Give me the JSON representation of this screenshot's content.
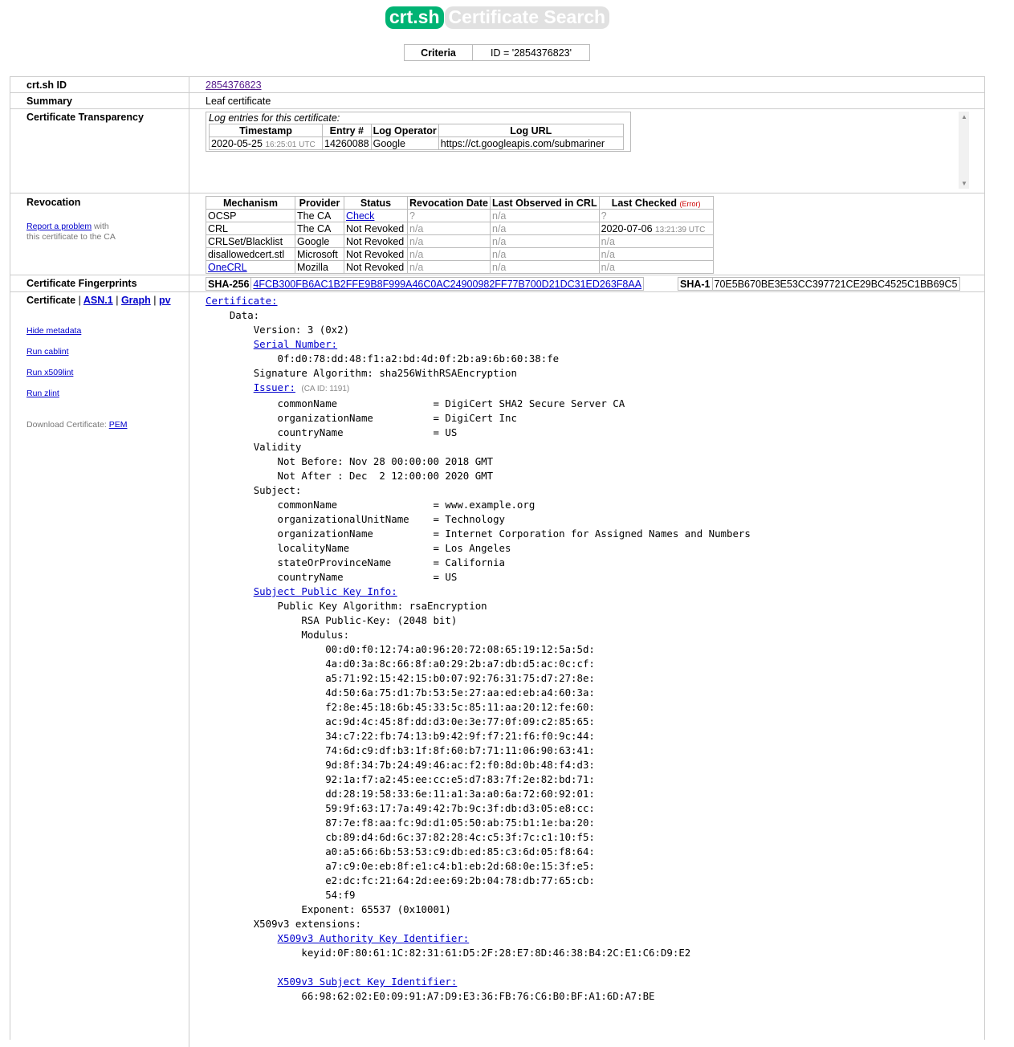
{
  "header": {
    "logo": "crt.sh",
    "title": "Certificate Search"
  },
  "criteria": {
    "label": "Criteria",
    "value": "ID = '2854376823'"
  },
  "rows": {
    "id_label": "crt.sh ID",
    "id_value": "2854376823",
    "summary_label": "Summary",
    "summary_value": "Leaf certificate",
    "ct_label": "Certificate Transparency",
    "revocation_label": "Revocation",
    "fingerprints_label": "Certificate Fingerprints",
    "certificate_label": "Certificate"
  },
  "ct": {
    "caption": "Log entries for this certificate:",
    "headers": [
      "Timestamp",
      "Entry #",
      "Log Operator",
      "Log URL"
    ],
    "entry": {
      "date": "2020-05-25",
      "time": "16:25:01 UTC",
      "entry": "14260088",
      "operator": "Google",
      "url": "https://ct.googleapis.com/submariner"
    }
  },
  "revocation": {
    "report_link": "Report a problem",
    "report_text1": "with",
    "report_text2": "this certificate to the CA",
    "headers": [
      "Mechanism",
      "Provider",
      "Status",
      "Revocation Date",
      "Last Observed in CRL",
      "Last Checked"
    ],
    "error_label": "(Error)",
    "rows": [
      {
        "mechanism": "OCSP",
        "provider": "The CA",
        "status": "Check",
        "revdate": "?",
        "observed": "n/a",
        "checked": "?",
        "checked_time": ""
      },
      {
        "mechanism": "CRL",
        "provider": "The CA",
        "status": "Not Revoked",
        "revdate": "n/a",
        "observed": "n/a",
        "checked": "2020-07-06",
        "checked_time": "13:21:39 UTC"
      },
      {
        "mechanism": "CRLSet/Blacklist",
        "provider": "Google",
        "status": "Not Revoked",
        "revdate": "n/a",
        "observed": "n/a",
        "checked": "n/a",
        "checked_time": ""
      },
      {
        "mechanism": "disallowedcert.stl",
        "provider": "Microsoft",
        "status": "Not Revoked",
        "revdate": "n/a",
        "observed": "n/a",
        "checked": "n/a",
        "checked_time": ""
      },
      {
        "mechanism": "OneCRL",
        "provider": "Mozilla",
        "status": "Not Revoked",
        "revdate": "n/a",
        "observed": "n/a",
        "checked": "n/a",
        "checked_time": ""
      }
    ]
  },
  "fingerprints": {
    "sha256_label": "SHA-256",
    "sha256": "4FCB300FB6AC1B2FFE9B8F999A46C0AC24900982FF77B700D21DC31ED263F8AA",
    "sha1_label": "SHA-1",
    "sha1": "70E5B670BE3E53CC397721CE29BC4525C1BB69C5"
  },
  "certificate_links": {
    "sep": "|",
    "asn1": "ASN.1",
    "graph": "Graph",
    "pv": "pv",
    "hide_metadata": "Hide metadata",
    "run_cablint": "Run cablint",
    "run_x509lint": "Run x509lint",
    "run_zlint": "Run zlint",
    "download_label": "Download Certificate:",
    "download_pem": "PEM"
  },
  "cert_text": {
    "certificate": "Certificate:",
    "data": "Data:",
    "version": "Version: 3 (0x2)",
    "serial_label": "Serial Number:",
    "serial": "0f:d0:78:dd:48:f1:a2:bd:4d:0f:2b:a9:6b:60:38:fe",
    "sigalg": "Signature Algorithm: sha256WithRSAEncryption",
    "issuer_label": "Issuer:",
    "issuer_caid": "(CA ID: 1191)",
    "issuer_lines": [
      "commonName                = DigiCert SHA2 Secure Server CA",
      "organizationName          = DigiCert Inc",
      "countryName               = US"
    ],
    "validity": "Validity",
    "not_before": "Not Before: Nov 28 00:00:00 2018 GMT",
    "not_after": "Not After : Dec  2 12:00:00 2020 GMT",
    "subject": "Subject:",
    "subject_lines": [
      "commonName                = www.example.org",
      "organizationalUnitName    = Technology",
      "organizationName          = Internet Corporation for Assigned Names and Numbers",
      "localityName              = Los Angeles",
      "stateOrProvinceName       = California",
      "countryName               = US"
    ],
    "spki_label": "Subject Public Key Info:",
    "pk_alg": "Public Key Algorithm: rsaEncryption",
    "rsa_key": "RSA Public-Key: (2048 bit)",
    "modulus": "Modulus:",
    "modulus_lines": [
      "00:d0:f0:12:74:a0:96:20:72:08:65:19:12:5a:5d:",
      "4a:d0:3a:8c:66:8f:a0:29:2b:a7:db:d5:ac:0c:cf:",
      "a5:71:92:15:42:15:b0:07:92:76:31:75:d7:27:8e:",
      "4d:50:6a:75:d1:7b:53:5e:27:aa:ed:eb:a4:60:3a:",
      "f2:8e:45:18:6b:45:33:5c:85:11:aa:20:12:fe:60:",
      "ac:9d:4c:45:8f:dd:d3:0e:3e:77:0f:09:c2:85:65:",
      "34:c7:22:fb:74:13:b9:42:9f:f7:21:f6:f0:9c:44:",
      "74:6d:c9:df:b3:1f:8f:60:b7:71:11:06:90:63:41:",
      "9d:8f:34:7b:24:49:46:ac:f2:f0:8d:0b:48:f4:d3:",
      "92:1a:f7:a2:45:ee:cc:e5:d7:83:7f:2e:82:bd:71:",
      "dd:28:19:58:33:6e:11:a1:3a:a0:6a:72:60:92:01:",
      "59:9f:63:17:7a:49:42:7b:9c:3f:db:d3:05:e8:cc:",
      "87:7e:f8:aa:fc:9d:d1:05:50:ab:75:b1:1e:ba:20:",
      "cb:89:d4:6d:6c:37:82:28:4c:c5:3f:7c:c1:10:f5:",
      "a0:a5:66:6b:53:53:c9:db:ed:85:c3:6d:05:f8:64:",
      "a7:c9:0e:eb:8f:e1:c4:b1:eb:2d:68:0e:15:3f:e5:",
      "e2:dc:fc:21:64:2d:ee:69:2b:04:78:db:77:65:cb:",
      "54:f9"
    ],
    "exponent": "Exponent: 65537 (0x10001)",
    "x509v3": "X509v3 extensions:",
    "aki_label": "X509v3 Authority Key Identifier:",
    "aki": "keyid:0F:80:61:1C:82:31:61:D5:2F:28:E7:8D:46:38:B4:2C:E1:C6:D9:E2",
    "ski_label": "X509v3 Subject Key Identifier:",
    "ski": "66:98:62:02:E0:09:91:A7:D9:E3:36:FB:76:C6:B0:BF:A1:6D:A7:BE"
  }
}
